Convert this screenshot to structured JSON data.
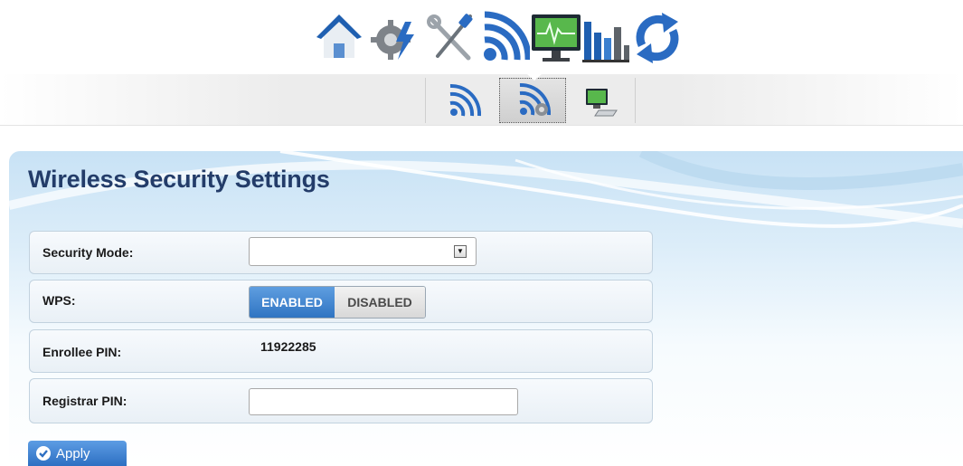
{
  "top_nav": {
    "icons": [
      "home-icon",
      "settings-icon",
      "tools-icon",
      "wireless-icon",
      "monitor-icon",
      "statistics-icon",
      "refresh-icon"
    ]
  },
  "sub_nav": {
    "icons": [
      "wireless-basic-icon",
      "wireless-security-icon",
      "wireless-client-icon"
    ],
    "active": "wireless-security-icon"
  },
  "page": {
    "title": "Wireless Security Settings"
  },
  "form": {
    "security_mode": {
      "label": "Security Mode:",
      "value": ""
    },
    "wps": {
      "label": "WPS:",
      "enabled_label": "ENABLED",
      "disabled_label": "DISABLED",
      "selected": "ENABLED"
    },
    "enrollee_pin": {
      "label": "Enrollee PIN:",
      "value": "11922285"
    },
    "registrar_pin": {
      "label": "Registrar PIN:",
      "value": ""
    }
  },
  "apply": {
    "label": "Apply"
  },
  "colors": {
    "title": "#233c69",
    "accent": "#2f74c2",
    "banner": "#c8e2f5"
  }
}
